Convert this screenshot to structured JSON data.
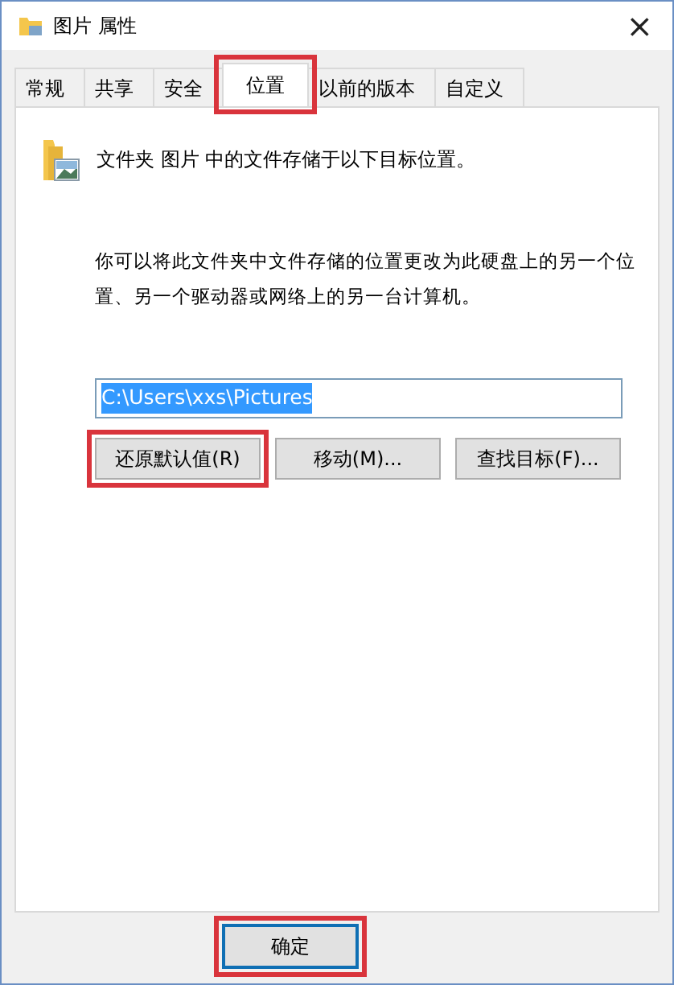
{
  "window": {
    "title": "图片 属性",
    "close": "×"
  },
  "tabs": [
    {
      "label": "常规",
      "selected": false,
      "highlighted": false
    },
    {
      "label": "共享",
      "selected": false,
      "highlighted": false
    },
    {
      "label": "安全",
      "selected": false,
      "highlighted": false
    },
    {
      "label": "位置",
      "selected": true,
      "highlighted": true
    },
    {
      "label": "以前的版本",
      "selected": false,
      "highlighted": false
    },
    {
      "label": "自定义",
      "selected": false,
      "highlighted": false
    }
  ],
  "location": {
    "heading": "文件夹 图片 中的文件存储于以下目标位置。",
    "description": "你可以将此文件夹中文件存储的位置更改为此硬盘上的另一个位置、另一个驱动器或网络上的另一台计算机。",
    "path": {
      "value": "C:\\Users\\xxs\\Pictures",
      "text_selected": true
    },
    "buttons": [
      {
        "label": "还原默认值(R)",
        "highlighted": true
      },
      {
        "label": "移动(M)...",
        "highlighted": false
      },
      {
        "label": "查找目标(F)...",
        "highlighted": false
      }
    ]
  },
  "footer_buttons": [
    {
      "label": "确定",
      "default": true,
      "highlighted": true
    }
  ]
}
